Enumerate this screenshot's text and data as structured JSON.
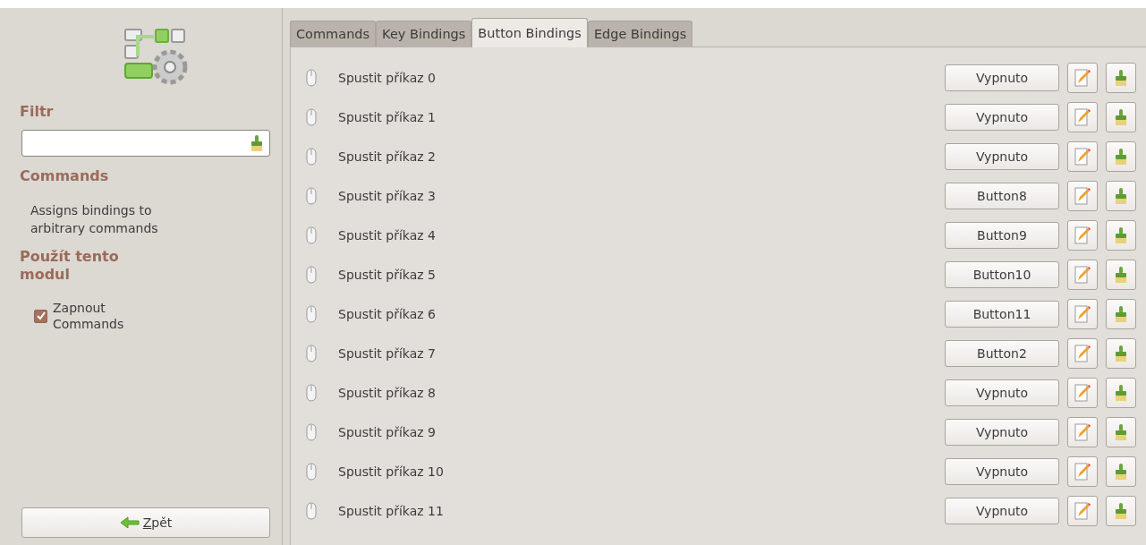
{
  "sidebar": {
    "filter_heading": "Filtr",
    "module_heading": "Commands",
    "description": "Assigns bindings to arbitrary commands",
    "use_heading": "Použít tento modul",
    "enable": {
      "label": "Zapnout Commands",
      "checked": true
    },
    "back_button": "Zpět"
  },
  "tabs": [
    {
      "label": "Commands",
      "selected": false
    },
    {
      "label": "Key Bindings",
      "selected": false
    },
    {
      "label": "Button Bindings",
      "selected": true
    },
    {
      "label": "Edge Bindings",
      "selected": false
    }
  ],
  "bindings": [
    {
      "name": "Spustit příkaz 0",
      "binding": "Vypnuto"
    },
    {
      "name": "Spustit příkaz 1",
      "binding": "Vypnuto"
    },
    {
      "name": "Spustit příkaz 2",
      "binding": "Vypnuto"
    },
    {
      "name": "Spustit příkaz 3",
      "binding": "Button8"
    },
    {
      "name": "Spustit příkaz 4",
      "binding": "Button9"
    },
    {
      "name": "Spustit příkaz 5",
      "binding": "Button10"
    },
    {
      "name": "Spustit příkaz 6",
      "binding": "Button11"
    },
    {
      "name": "Spustit příkaz 7",
      "binding": "Button2"
    },
    {
      "name": "Spustit příkaz 8",
      "binding": "Vypnuto"
    },
    {
      "name": "Spustit příkaz 9",
      "binding": "Vypnuto"
    },
    {
      "name": "Spustit příkaz 10",
      "binding": "Vypnuto"
    },
    {
      "name": "Spustit příkaz 11",
      "binding": "Vypnuto"
    }
  ]
}
